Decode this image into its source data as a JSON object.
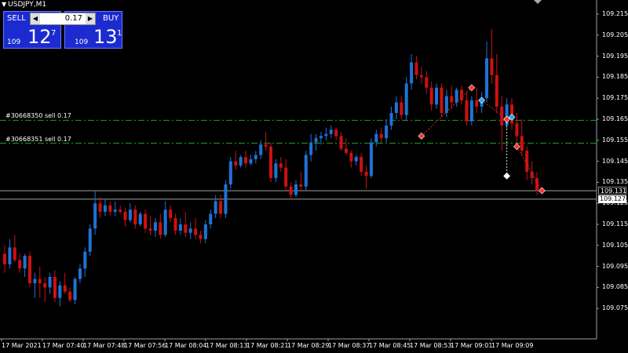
{
  "title": "USDJPY,M1",
  "trade_panel": {
    "sell_label": "SELL",
    "buy_label": "BUY",
    "lot_value": "0.17",
    "sell_price_prefix": "109",
    "sell_price_big": "12",
    "sell_price_sup": "7",
    "buy_price_prefix": "109",
    "buy_price_big": "13",
    "buy_price_sup": "1"
  },
  "orders": [
    {
      "label": "#30668350 sell 0.17",
      "price": 109.1645
    },
    {
      "label": "#30668351 sell 0.17",
      "price": 109.1536
    }
  ],
  "colors": {
    "background": "#000000",
    "bull_candle": "#1e73d8",
    "bear_candle": "#cc1111",
    "doji": "#e0e000",
    "order_line": "#1c9e1c",
    "grid_axis": "#a0a0a0",
    "bid_line": "#a0a0a0",
    "ask_box": "#ffffff"
  },
  "chart_data": {
    "type": "candlestick",
    "symbol": "USDJPY",
    "timeframe": "M1",
    "ylim": [
      109.065,
      109.215
    ],
    "price_axis": [
      "109.215",
      "109.205",
      "109.195",
      "109.185",
      "109.175",
      "109.165",
      "109.155",
      "109.145",
      "109.135",
      "109.125",
      "109.115",
      "109.105",
      "109.095",
      "109.085",
      "109.075"
    ],
    "time_labels": [
      "17 Mar 2021",
      "17 Mar 07:40",
      "17 Mar 07:48",
      "17 Mar 07:56",
      "17 Mar 08:04",
      "17 Mar 08:13",
      "17 Mar 08:21",
      "17 Mar 08:29",
      "17 Mar 08:37",
      "17 Mar 08:45",
      "17 Mar 08:53",
      "17 Mar 09:01",
      "17 Mar 09:09"
    ],
    "bid": "109.131",
    "bid_value": 109.131,
    "ask": "109.127",
    "ask_value": 109.127,
    "candles": [
      [
        109.101,
        109.105,
        109.092,
        109.096
      ],
      [
        109.096,
        109.108,
        109.094,
        109.104
      ],
      [
        109.104,
        109.11,
        109.097,
        109.098
      ],
      [
        109.098,
        109.101,
        109.092,
        109.094
      ],
      [
        109.094,
        109.101,
        109.09,
        109.1
      ],
      [
        109.1,
        109.102,
        109.085,
        109.087
      ],
      [
        109.087,
        109.092,
        109.08,
        109.089
      ],
      [
        109.089,
        109.095,
        109.08,
        109.087
      ],
      [
        109.087,
        109.09,
        109.078,
        109.085
      ],
      [
        109.085,
        109.092,
        109.082,
        109.09
      ],
      [
        109.09,
        109.093,
        109.078,
        109.08
      ],
      [
        109.08,
        109.088,
        109.076,
        109.086
      ],
      [
        109.086,
        109.092,
        109.082,
        109.083
      ],
      [
        109.083,
        109.085,
        109.078,
        109.079
      ],
      [
        109.079,
        109.09,
        109.077,
        109.089
      ],
      [
        109.089,
        109.096,
        109.087,
        109.094
      ],
      [
        109.094,
        109.104,
        109.09,
        109.102
      ],
      [
        109.102,
        109.115,
        109.1,
        109.113
      ],
      [
        109.113,
        109.131,
        109.11,
        109.125
      ],
      [
        109.125,
        109.128,
        109.118,
        109.121
      ],
      [
        109.121,
        109.127,
        109.119,
        109.124
      ],
      [
        109.124,
        109.126,
        109.119,
        109.121
      ],
      [
        109.121,
        109.126,
        109.119,
        109.122
      ],
      [
        109.122,
        109.124,
        109.12,
        109.121
      ],
      [
        109.121,
        109.123,
        109.114,
        109.117
      ],
      [
        109.117,
        109.125,
        109.116,
        109.122
      ],
      [
        109.122,
        109.124,
        109.113,
        109.115
      ],
      [
        109.115,
        109.121,
        109.114,
        109.12
      ],
      [
        109.12,
        109.122,
        109.111,
        109.113
      ],
      [
        109.113,
        109.119,
        109.11,
        109.112
      ],
      [
        109.112,
        109.118,
        109.109,
        109.116
      ],
      [
        109.116,
        109.12,
        109.108,
        109.11
      ],
      [
        109.11,
        109.126,
        109.109,
        109.122
      ],
      [
        109.122,
        109.124,
        109.116,
        109.118
      ],
      [
        109.118,
        109.12,
        109.11,
        109.112
      ],
      [
        109.112,
        109.118,
        109.11,
        109.115
      ],
      [
        109.115,
        109.121,
        109.109,
        109.111
      ],
      [
        109.111,
        109.116,
        109.108,
        109.113
      ],
      [
        109.113,
        109.118,
        109.108,
        109.11
      ],
      [
        109.11,
        109.112,
        109.106,
        109.108
      ],
      [
        109.108,
        109.117,
        109.106,
        109.115
      ],
      [
        109.115,
        109.122,
        109.113,
        109.12
      ],
      [
        109.12,
        109.129,
        109.118,
        109.126
      ],
      [
        109.126,
        109.129,
        109.118,
        109.12
      ],
      [
        109.12,
        109.136,
        109.118,
        109.134
      ],
      [
        109.134,
        109.147,
        109.132,
        109.145
      ],
      [
        109.145,
        109.15,
        109.141,
        109.143
      ],
      [
        109.143,
        109.148,
        109.142,
        109.147
      ],
      [
        109.147,
        109.15,
        109.142,
        109.144
      ],
      [
        109.144,
        109.148,
        109.143,
        109.146
      ],
      [
        109.146,
        109.15,
        109.144,
        109.148
      ],
      [
        109.148,
        109.155,
        109.146,
        109.153
      ],
      [
        109.153,
        109.159,
        109.15,
        109.152
      ],
      [
        109.152,
        109.154,
        109.135,
        109.137
      ],
      [
        109.137,
        109.146,
        109.135,
        109.144
      ],
      [
        109.144,
        109.147,
        109.14,
        109.142
      ],
      [
        109.142,
        109.146,
        109.131,
        109.133
      ],
      [
        109.133,
        109.135,
        109.127,
        109.129
      ],
      [
        109.129,
        109.136,
        109.128,
        109.134
      ],
      [
        109.134,
        109.14,
        109.131,
        109.133
      ],
      [
        109.133,
        109.15,
        109.131,
        109.148
      ],
      [
        109.148,
        109.158,
        109.145,
        109.154
      ],
      [
        109.154,
        109.158,
        109.15,
        109.156
      ],
      [
        109.156,
        109.159,
        109.153,
        109.157
      ],
      [
        109.157,
        109.161,
        109.155,
        109.158
      ],
      [
        109.158,
        109.162,
        109.156,
        109.16
      ],
      [
        109.16,
        109.161,
        109.155,
        109.157
      ],
      [
        109.157,
        109.159,
        109.15,
        109.151
      ],
      [
        109.151,
        109.156,
        109.148,
        109.149
      ],
      [
        109.149,
        109.15,
        109.142,
        109.145
      ],
      [
        109.145,
        109.148,
        109.143,
        109.147
      ],
      [
        109.147,
        109.149,
        109.138,
        109.14
      ],
      [
        109.14,
        109.143,
        109.132,
        109.138
      ],
      [
        109.138,
        109.156,
        109.137,
        109.154
      ],
      [
        109.154,
        109.16,
        109.152,
        109.158
      ],
      [
        109.158,
        109.161,
        109.154,
        109.156
      ],
      [
        109.156,
        109.165,
        109.154,
        109.162
      ],
      [
        109.162,
        109.171,
        109.16,
        109.168
      ],
      [
        109.168,
        109.176,
        109.165,
        109.173
      ],
      [
        109.173,
        109.176,
        109.165,
        109.167
      ],
      [
        109.167,
        109.185,
        109.164,
        109.182
      ],
      [
        109.182,
        109.196,
        109.179,
        109.192
      ],
      [
        109.192,
        109.195,
        109.184,
        109.186
      ],
      [
        109.186,
        109.19,
        109.182,
        109.185
      ],
      [
        109.185,
        109.188,
        109.177,
        109.18
      ],
      [
        109.18,
        109.183,
        109.169,
        109.172
      ],
      [
        109.172,
        109.182,
        109.17,
        109.18
      ],
      [
        109.18,
        109.182,
        109.166,
        109.168
      ],
      [
        109.168,
        109.179,
        109.166,
        109.176
      ],
      [
        109.176,
        109.181,
        109.17,
        109.173
      ],
      [
        109.173,
        109.18,
        109.171,
        109.179
      ],
      [
        109.179,
        109.181,
        109.172,
        109.174
      ],
      [
        109.174,
        109.178,
        109.162,
        109.164
      ],
      [
        109.164,
        109.176,
        109.162,
        109.174
      ],
      [
        109.174,
        109.18,
        109.168,
        109.171
      ],
      [
        109.171,
        109.178,
        109.168,
        109.175
      ],
      [
        109.175,
        109.202,
        109.173,
        109.194
      ],
      [
        109.194,
        109.208,
        109.182,
        109.186
      ],
      [
        109.186,
        109.196,
        109.168,
        109.171
      ],
      [
        109.171,
        109.176,
        109.15,
        109.162
      ],
      [
        109.162,
        109.175,
        109.16,
        109.172
      ],
      [
        109.172,
        109.175,
        109.16,
        109.163
      ],
      [
        109.163,
        109.168,
        109.15,
        109.157
      ],
      [
        109.157,
        109.165,
        109.148,
        109.15
      ],
      [
        109.15,
        109.152,
        109.136,
        109.14
      ],
      [
        109.14,
        109.145,
        109.134,
        109.137
      ],
      [
        109.137,
        109.14,
        109.129,
        109.131
      ]
    ]
  }
}
